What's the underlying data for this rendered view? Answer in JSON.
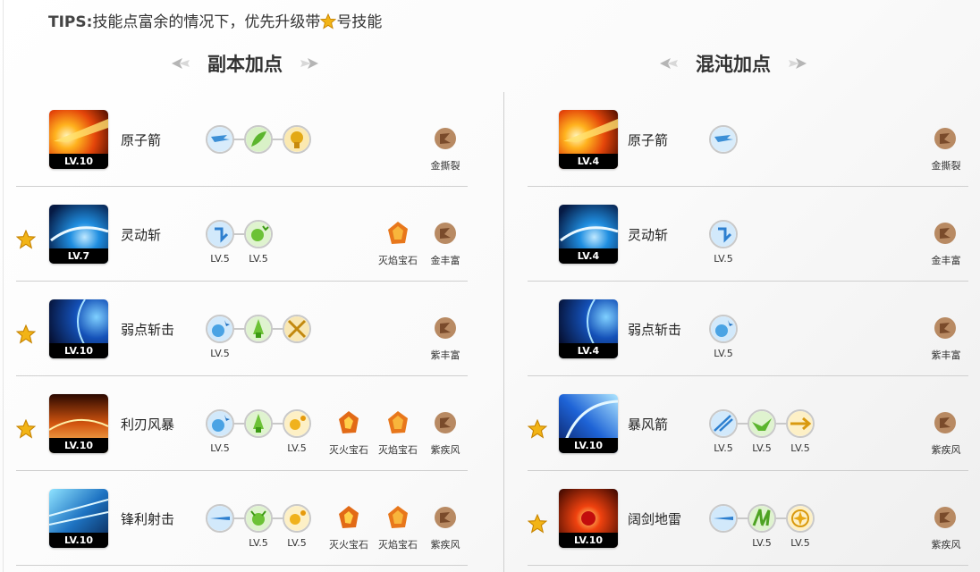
{
  "tips": {
    "prefix": "TIPS:",
    "text_before": "技能点富余的情况下，优先升级带",
    "text_after": "号技能"
  },
  "sections": {
    "left_title": "副本加点",
    "right_title": "混沌加点"
  },
  "left": {
    "rows": [
      {
        "name": "原子箭",
        "level": "LV.10",
        "starred": false,
        "runes": [
          "",
          "",
          ""
        ],
        "gem1": "",
        "gem2": "金撕裂"
      },
      {
        "name": "灵动斩",
        "level": "LV.7",
        "starred": true,
        "runes": [
          "LV.5",
          "LV.5"
        ],
        "gem1": "灭焰宝石",
        "gem2": "金丰富"
      },
      {
        "name": "弱点斩击",
        "level": "LV.10",
        "starred": true,
        "runes": [
          "LV.5",
          "",
          ""
        ],
        "gem1": "",
        "gem2": "紫丰富"
      },
      {
        "name": "利刃风暴",
        "level": "LV.10",
        "starred": true,
        "runes": [
          "LV.5",
          "",
          "LV.5"
        ],
        "gem0": "灭火宝石",
        "gem1": "灭焰宝石",
        "gem2": "紫疾风"
      },
      {
        "name": "锋利射击",
        "level": "LV.10",
        "starred": false,
        "runes": [
          "",
          "LV.5",
          "LV.5"
        ],
        "gem0": "灭火宝石",
        "gem1": "灭焰宝石",
        "gem2": "紫疾风"
      }
    ]
  },
  "right": {
    "rows": [
      {
        "name": "原子箭",
        "level": "LV.4",
        "starred": false,
        "runes": [
          ""
        ],
        "gem2": "金撕裂"
      },
      {
        "name": "灵动斩",
        "level": "LV.4",
        "starred": false,
        "runes": [
          "LV.5"
        ],
        "gem2": "金丰富"
      },
      {
        "name": "弱点斩击",
        "level": "LV.4",
        "starred": false,
        "runes": [
          "LV.5"
        ],
        "gem2": "紫丰富"
      },
      {
        "name": "暴风箭",
        "level": "LV.10",
        "starred": true,
        "runes": [
          "LV.5",
          "LV.5",
          "LV.5"
        ],
        "gem2": "紫疾风"
      },
      {
        "name": "阔剑地雷",
        "level": "LV.10",
        "starred": true,
        "runes": [
          "",
          "LV.5",
          "LV.5"
        ],
        "gem2": "紫疾风"
      }
    ]
  },
  "colors": {
    "star": "#f2b416",
    "divider": "#cfcfcf",
    "level_bar": "#000000"
  }
}
